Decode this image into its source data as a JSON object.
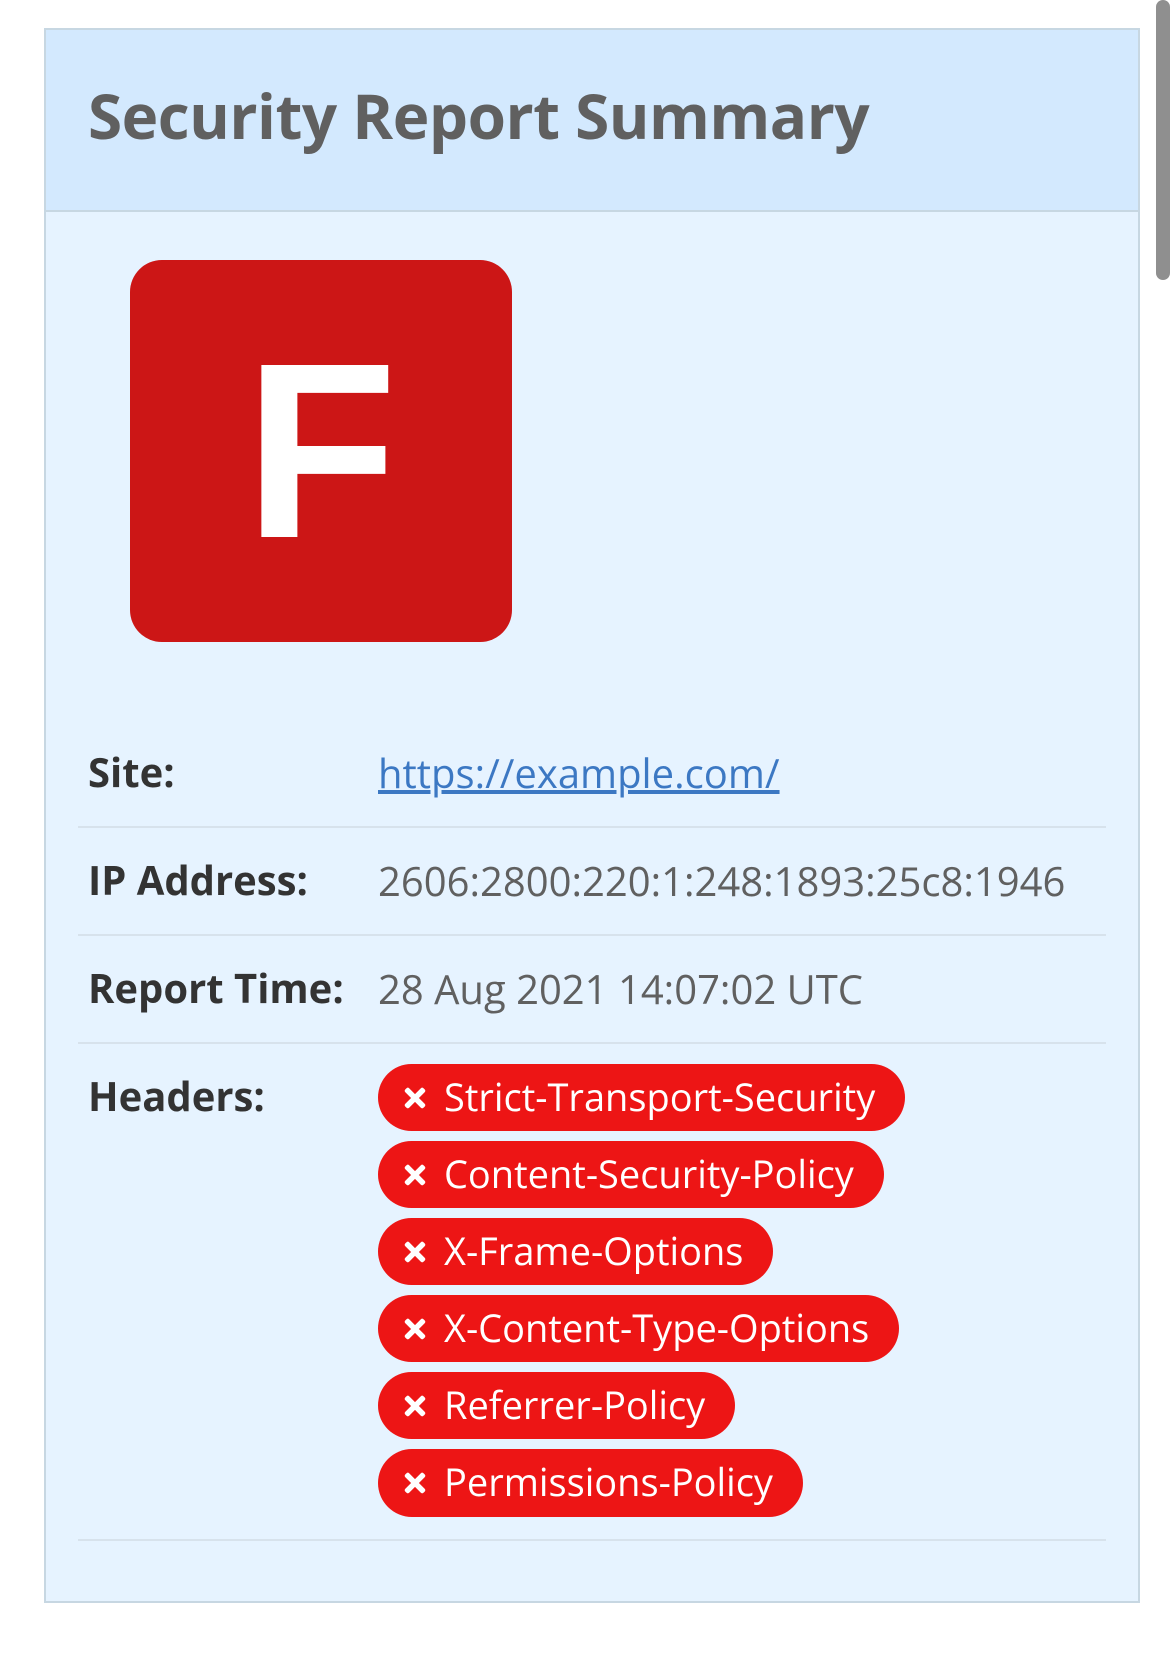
{
  "panel": {
    "title": "Security Report Summary",
    "grade": "F",
    "grade_color": "#cc1616"
  },
  "report": {
    "site_label": "Site:",
    "site_url": "https://example.com/",
    "ip_label": "IP Address:",
    "ip_value": "2606:2800:220:1:248:1893:25c8:1946",
    "time_label": "Report Time:",
    "time_value": "28 Aug 2021 14:07:02 UTC",
    "headers_label": "Headers:",
    "headers": [
      "Strict-Transport-Security",
      "Content-Security-Policy",
      "X-Frame-Options",
      "X-Content-Type-Options",
      "Referrer-Policy",
      "Permissions-Policy"
    ]
  }
}
